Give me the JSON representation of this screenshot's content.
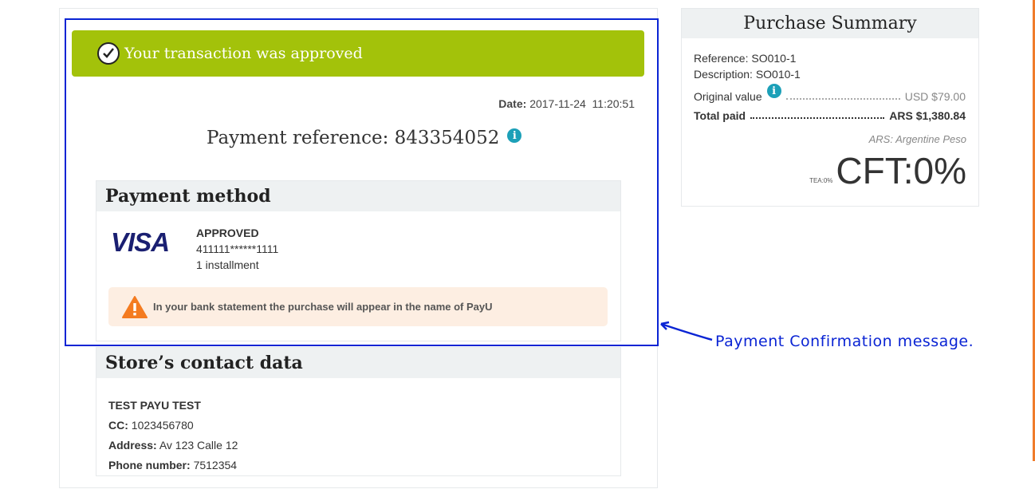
{
  "transaction": {
    "approved_message": "Your transaction was approved",
    "date_label": "Date:",
    "date_value": "2017-11-24  11:20:51",
    "payment_reference_label": "Payment reference:",
    "payment_reference_value": "843354052"
  },
  "payment_method": {
    "title": "Payment method",
    "card_brand": "VISA",
    "status": "APPROVED",
    "card_number": "411111******1111",
    "installments": "1 installment",
    "warning": "In your bank statement the purchase will appear in the name of PayU"
  },
  "store_contact": {
    "title": "Store’s contact data",
    "name": "TEST PAYU TEST",
    "cc_label": "CC:",
    "cc_value": "1023456780",
    "address_label": "Address:",
    "address_value": "Av 123 Calle 12",
    "phone_label": "Phone number:",
    "phone_value": "7512354"
  },
  "summary": {
    "title": "Purchase Summary",
    "reference_label": "Reference:",
    "reference_value": "SO010-1",
    "description_label": "Description:",
    "description_value": "SO010-1",
    "original_value_label": "Original value",
    "original_value": "USD $79.00",
    "total_paid_label": "Total paid",
    "total_paid_value": "ARS $1,380.84",
    "currency_note": "ARS: Argentine Peso",
    "tea": "TEA:0%",
    "cft": "CFT:0%"
  },
  "annotation": {
    "label": "Payment Confirmation message."
  },
  "colors": {
    "approved_green": "#a3c20a",
    "info_blue": "#1ca0b8",
    "warning_orange": "#f47b20",
    "annotation_blue": "#0a24d4",
    "visa_navy": "#1a1f71"
  }
}
